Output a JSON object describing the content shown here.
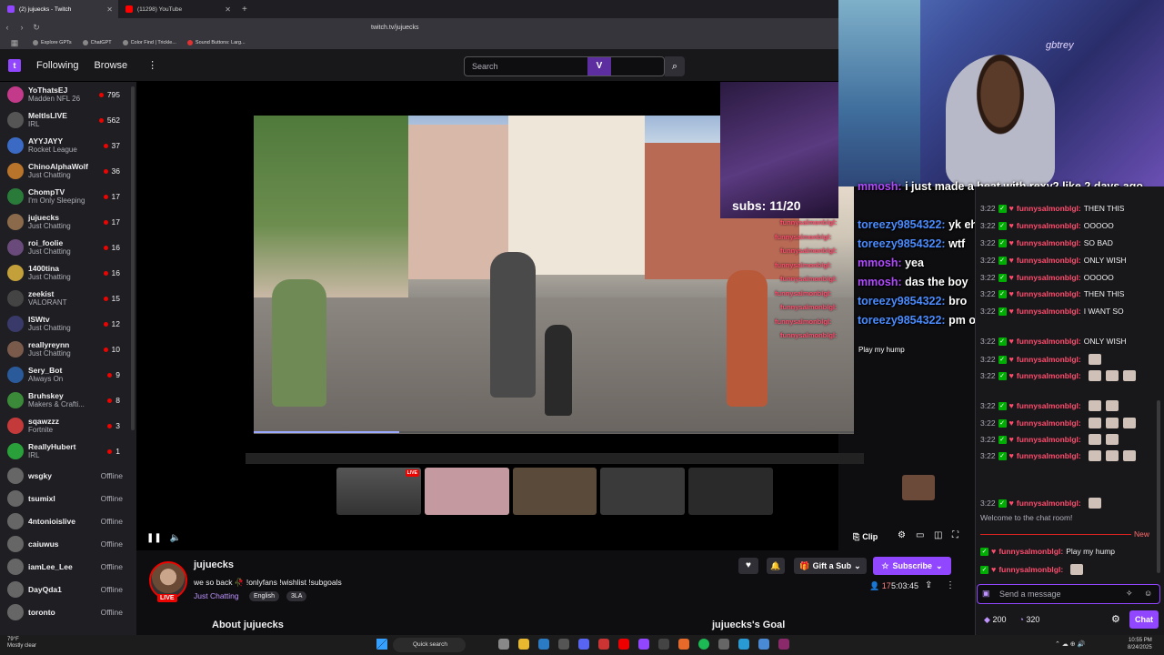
{
  "browser": {
    "tabs": [
      {
        "label": "(2) jujuecks - Twitch",
        "active": true
      },
      {
        "label": "(11298) YouTube",
        "active": false
      }
    ],
    "url": "twitch.tv/jujuecks",
    "bookmarks": [
      "Explore GPTs",
      "ChatGPT",
      "Color Find | Trickle...",
      "Sound Buttons: Larg..."
    ]
  },
  "twitch_nav": {
    "following": "Following",
    "browse": "Browse",
    "more": "⋮",
    "search_placeholder": "Search",
    "ext_logo": "V"
  },
  "sidebar": {
    "live": [
      {
        "name": "YoThatsEJ",
        "game": "Madden NFL 26",
        "viewers": "795",
        "color": "#c43a8a"
      },
      {
        "name": "MeltIsLIVE",
        "game": "IRL",
        "viewers": "562",
        "color": "#555"
      },
      {
        "name": "AYYJAYY",
        "game": "Rocket League",
        "viewers": "37",
        "color": "#3a6ac4"
      },
      {
        "name": "ChinoAlphaWolf",
        "game": "Just Chatting",
        "viewers": "36",
        "color": "#b8742a"
      },
      {
        "name": "ChompTV",
        "game": "I'm Only Sleeping",
        "viewers": "17",
        "color": "#2a7a3a"
      },
      {
        "name": "jujuecks",
        "game": "Just Chatting",
        "viewers": "17",
        "color": "#8a6a4a"
      },
      {
        "name": "roi_foolie",
        "game": "Just Chatting",
        "viewers": "16",
        "color": "#6a4a7a"
      },
      {
        "name": "1400tina",
        "game": "Just Chatting",
        "viewers": "16",
        "color": "#c4a03a"
      },
      {
        "name": "zeekist",
        "game": "VALORANT",
        "viewers": "15",
        "color": "#444"
      },
      {
        "name": "ISWtv",
        "game": "Just Chatting",
        "viewers": "12",
        "color": "#3a3a6a"
      },
      {
        "name": "reallyreynn",
        "game": "Just Chatting",
        "viewers": "10",
        "color": "#7a5a4a"
      },
      {
        "name": "Sery_Bot",
        "game": "Always On",
        "viewers": "9",
        "color": "#2a5a9a"
      },
      {
        "name": "Bruhskey",
        "game": "Makers & Crafti...",
        "viewers": "8",
        "color": "#3a8a3a"
      },
      {
        "name": "sqawzzz",
        "game": "Fortnite",
        "viewers": "3",
        "color": "#c43a3a"
      },
      {
        "name": "ReallyHubert",
        "game": "IRL",
        "viewers": "1",
        "color": "#2aa03a"
      }
    ],
    "offline": [
      {
        "name": "wsgky",
        "status": "Offline"
      },
      {
        "name": "tsumixl",
        "status": "Offline"
      },
      {
        "name": "4ntonioislive",
        "status": "Offline"
      },
      {
        "name": "caiuwus",
        "status": "Offline"
      },
      {
        "name": "iamLee_Lee",
        "status": "Offline"
      },
      {
        "name": "DayQda1",
        "status": "Offline"
      },
      {
        "name": "toronto",
        "status": "Offline"
      }
    ]
  },
  "stream": {
    "subs_overlay": "subs: 11/20",
    "live_badge": "LIVE",
    "overlay_chat": [
      {
        "user": "mmosh:",
        "text": "i just made a beat with rexy2 like 2 days ago"
      },
      {
        "user": "toreezy9854322:",
        "text": "yk ehh?"
      },
      {
        "user": "toreezy9854322:",
        "text": "wtf"
      },
      {
        "user": "mmosh:",
        "text": "yea"
      },
      {
        "user": "mmosh:",
        "text": "das the boy"
      },
      {
        "user": "toreezy9854322:",
        "text": "bro"
      },
      {
        "user": "toreezy9854322:",
        "text": "pm on"
      }
    ],
    "overlay_mini_user": "funnysalmonblgl:",
    "overlay_hump": "Play my hump",
    "webcam_sign": "gbtrey"
  },
  "controls": {
    "play": "❚❚",
    "mute": "🔈",
    "clip": "Clip"
  },
  "channel": {
    "name": "jujuecks",
    "live": "LIVE",
    "title": "we so back 🥀 !onlyfans !wishlist !subgoals",
    "category": "Just Chatting",
    "tags": [
      "English",
      "3LA"
    ],
    "gift_sub": "Gift a Sub",
    "subscribe": "Subscribe",
    "viewers": "17",
    "uptime": "5:03:45",
    "about": "About jujuecks",
    "goal": "jujuecks's Goal"
  },
  "chat": {
    "messages": [
      {
        "time": "3:22",
        "user": "funnysalmonblgl:",
        "text": "THEN THIS",
        "emotes": 0
      },
      {
        "time": "3:22",
        "user": "funnysalmonblgl:",
        "text": "OOOOO",
        "emotes": 0
      },
      {
        "time": "3:22",
        "user": "funnysalmonblgl:",
        "text": "SO BAD",
        "emotes": 0
      },
      {
        "time": "3:22",
        "user": "funnysalmonblgl:",
        "text": "ONLY WISH",
        "emotes": 0
      },
      {
        "time": "3:22",
        "user": "funnysalmonblgl:",
        "text": "OOOOO",
        "emotes": 0
      },
      {
        "time": "3:22",
        "user": "funnysalmonblgl:",
        "text": "THEN THIS",
        "emotes": 0
      },
      {
        "time": "3:22",
        "user": "funnysalmonblgl:",
        "text": "I WANT SO",
        "emotes": 0
      },
      {
        "time": "3:22",
        "user": "funnysalmonblgl:",
        "text": "ONLY WISH",
        "emotes": 0
      },
      {
        "time": "3:22",
        "user": "funnysalmonblgl:",
        "text": "",
        "emotes": 1
      },
      {
        "time": "3:22",
        "user": "funnysalmonblgl:",
        "text": "",
        "emotes": 3
      },
      {
        "time": "3:22",
        "user": "funnysalmonblgl:",
        "text": "",
        "emotes": 2
      },
      {
        "time": "3:22",
        "user": "funnysalmonblgl:",
        "text": "",
        "emotes": 3
      },
      {
        "time": "3:22",
        "user": "funnysalmonblgl:",
        "text": "",
        "emotes": 2
      },
      {
        "time": "3:22",
        "user": "funnysalmonblgl:",
        "text": "",
        "emotes": 3
      },
      {
        "time": "3:22",
        "user": "funnysalmonblgl:",
        "text": "",
        "emotes": 1
      }
    ],
    "welcome": "Welcome to the chat room!",
    "new_label": "New",
    "recent": [
      {
        "user": "funnysalmonblgl:",
        "text": "Play my hump"
      },
      {
        "user": "funnysalmonblgl:",
        "text": ""
      }
    ],
    "input_placeholder": "Send a message",
    "bits": "200",
    "points": "320",
    "chat_button": "Chat"
  },
  "taskbar": {
    "weather": "79°F",
    "weather_desc": "Mostly clear",
    "search": "Quick search",
    "time": "10:55 PM",
    "date": "8/24/2025"
  }
}
